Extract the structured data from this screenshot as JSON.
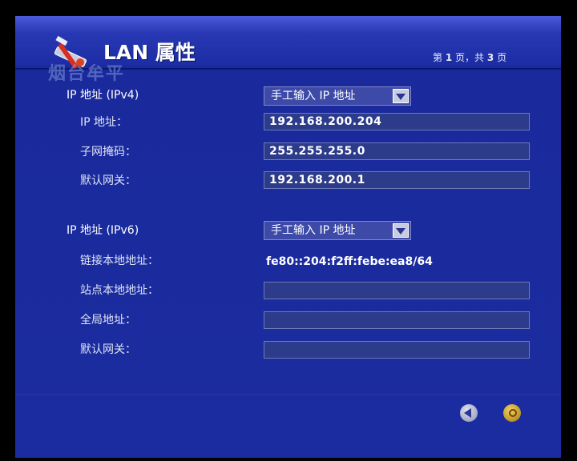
{
  "header": {
    "title": "LAN 属性",
    "watermark": "烟台牟平",
    "page_indicator": {
      "prefix": "第",
      "current": "1",
      "middle": "页，共",
      "total": "3",
      "suffix": "页"
    }
  },
  "ipv4": {
    "section_label": "IP 地址 (IPv4)",
    "mode": "手工输入 IP 地址",
    "fields": [
      {
        "label": "IP 地址：",
        "value": "192.168.200.204"
      },
      {
        "label": "子网掩码：",
        "value": "255.255.255.0"
      },
      {
        "label": "默认网关：",
        "value": "192.168.200.1"
      }
    ]
  },
  "ipv6": {
    "section_label": "IP 地址 (IPv6)",
    "mode": "手工输入 IP 地址",
    "link_local_label": "链接本地地址：",
    "link_local_value": "fe80::204:f2ff:febe:ea8/64",
    "fields": [
      {
        "label": "站点本地地址：",
        "value": ""
      },
      {
        "label": "全局地址：",
        "value": ""
      },
      {
        "label": "默认网关：",
        "value": ""
      }
    ]
  },
  "footer": {
    "back_icon": "back-arrow-icon",
    "ok_icon": "ok-icon"
  }
}
